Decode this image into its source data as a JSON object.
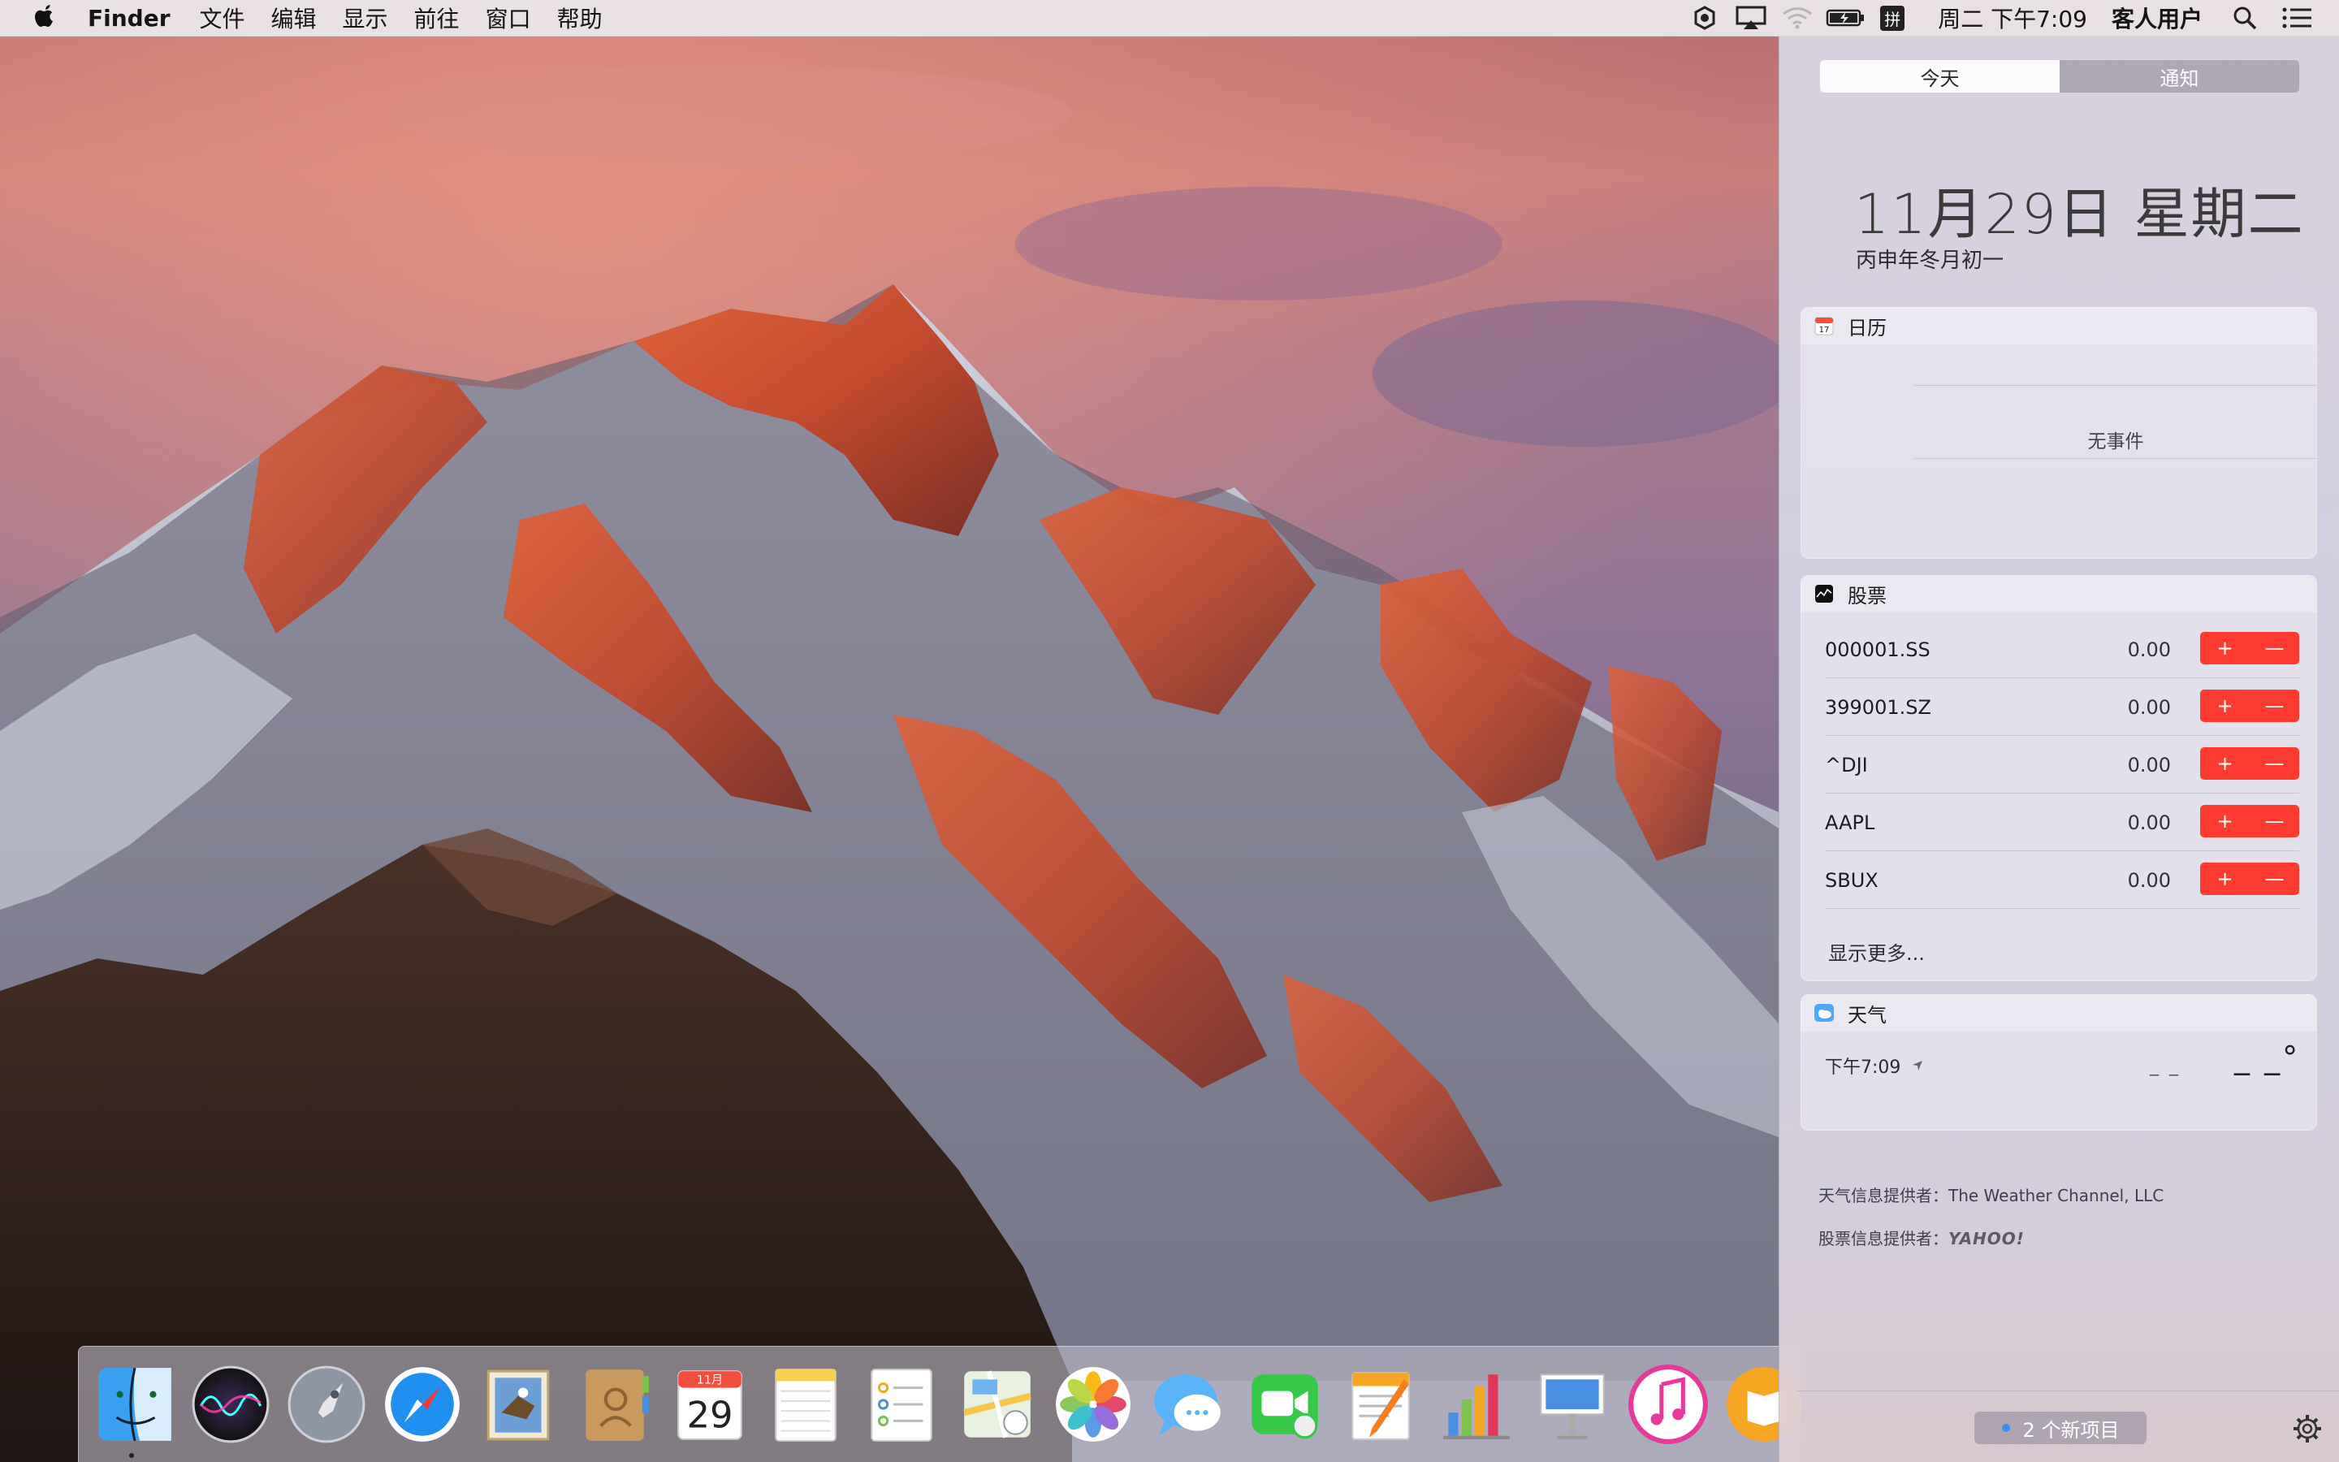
{
  "menubar": {
    "apple_icon": "apple-icon",
    "app_name": "Finder",
    "menus": [
      "文件",
      "编辑",
      "显示",
      "前往",
      "窗口",
      "帮助"
    ],
    "status_icons": [
      "time-machine-icon",
      "airplay-icon",
      "wifi-icon",
      "battery-icon",
      "input-method-icon"
    ],
    "input_method": "拼",
    "clock": "周二 下午7:09",
    "user": "客人用户",
    "search_icon": "spotlight-icon",
    "list_icon": "notification-center-icon"
  },
  "notification_center": {
    "tabs": [
      {
        "label": "今天",
        "active": true
      },
      {
        "label": "通知",
        "active": false
      }
    ],
    "date": "11月29日 星期二",
    "lunar_date": "丙申年冬月初一",
    "calendar": {
      "title": "日历",
      "empty_text": "无事件"
    },
    "stocks": {
      "title": "股票",
      "rows": [
        {
          "symbol": "000001.SS",
          "value": "0.00"
        },
        {
          "symbol": "399001.SZ",
          "value": "0.00"
        },
        {
          "symbol": "^DJI",
          "value": "0.00"
        },
        {
          "symbol": "AAPL",
          "value": "0.00"
        },
        {
          "symbol": "SBUX",
          "value": "0.00"
        }
      ],
      "add_label": "+",
      "remove_label": "—",
      "show_more": "显示更多..."
    },
    "weather": {
      "title": "天气",
      "time": "下午7:09",
      "condition_placeholder": "_ _",
      "temperature_placeholder": "_ _°"
    },
    "credits": {
      "weather_prefix": "天气信息提供者：",
      "weather_provider": "The Weather Channel, LLC",
      "stocks_prefix": "股票信息提供者：",
      "stocks_provider": "YAHOO!"
    },
    "new_items": "2 个新项目",
    "accent_color": "#fd3b30"
  },
  "dock": {
    "apps": [
      "finder-icon",
      "siri-icon",
      "launchpad-icon",
      "safari-icon",
      "mail-icon",
      "contacts-icon",
      "calendar-icon",
      "notes-icon",
      "reminders-icon",
      "maps-icon",
      "photos-icon",
      "messages-icon",
      "facetime-icon",
      "pages-icon",
      "numbers-icon",
      "keynote-icon",
      "itunes-icon",
      "ibooks-icon"
    ],
    "calendar_month": "11月",
    "calendar_day": "29"
  }
}
